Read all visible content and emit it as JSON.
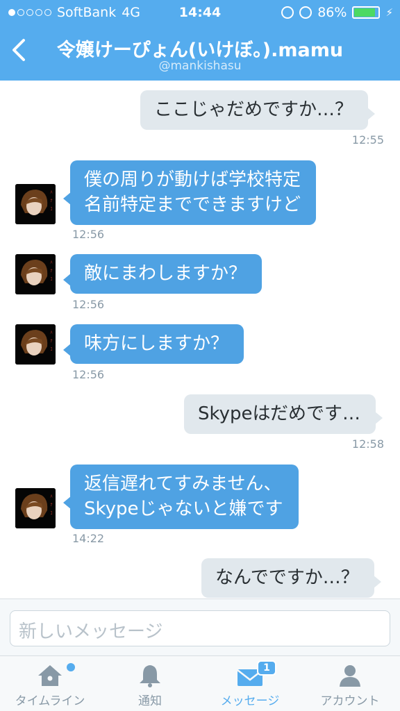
{
  "status": {
    "carrier": "SoftBank",
    "network": "4G",
    "time": "14:44",
    "battery": "86%",
    "battery_level": 0.86,
    "signal_bars_filled": 1,
    "signal_bars_total": 5
  },
  "header": {
    "back_icon": "chevron-left-icon",
    "title": "令嬢けーぴょん(いけぼ。).mamu",
    "handle": "@mankishasu"
  },
  "messages": [
    {
      "direction": "out",
      "text_lines": [
        "ここじゃだめですか…？"
      ],
      "time": "12:55"
    },
    {
      "direction": "in",
      "text_lines": [
        "僕の周りが動けば学校特定",
        "名前特定までできますけど"
      ],
      "time": "12:56"
    },
    {
      "direction": "in",
      "text_lines": [
        "敵にまわしますか？"
      ],
      "time": "12:56"
    },
    {
      "direction": "in",
      "text_lines": [
        "味方にしますか？"
      ],
      "time": "12:56"
    },
    {
      "direction": "out",
      "text_lines": [
        "Skypeはだめです…"
      ],
      "time": "12:58"
    },
    {
      "direction": "in",
      "text_lines": [
        "返信遅れてすみません、",
        "Skypeじゃないと嫌です"
      ],
      "time": "14:22"
    },
    {
      "direction": "out",
      "text_lines": [
        "なんでですか…？"
      ],
      "time": ""
    }
  ],
  "composer": {
    "placeholder": "新しいメッセージ"
  },
  "tabs": [
    {
      "label": "タイムライン",
      "icon": "home-icon"
    },
    {
      "label": "通知",
      "icon": "bell-icon"
    },
    {
      "label": "メッセージ",
      "icon": "envelope-icon",
      "badge": "1"
    },
    {
      "label": "アカウント",
      "icon": "person-icon"
    }
  ],
  "colors": {
    "brand": "#55acee",
    "incoming": "#4fa2e3",
    "outgoing": "#e1e8ed"
  }
}
